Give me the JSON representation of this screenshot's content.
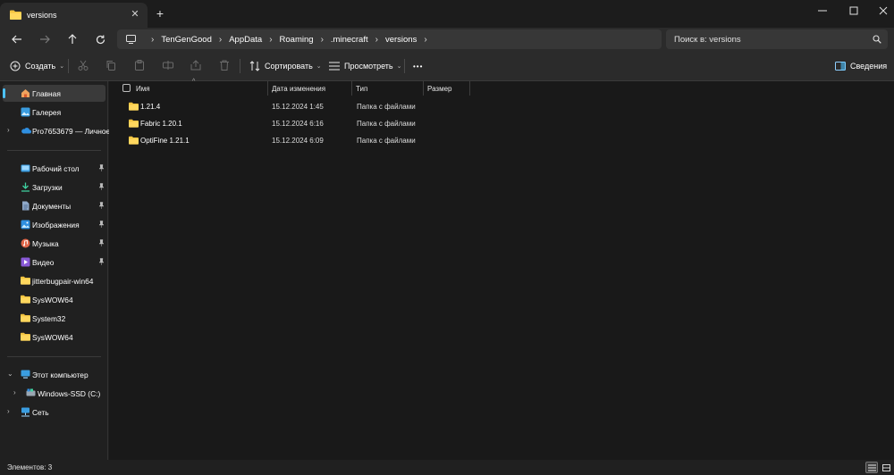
{
  "window": {
    "tab_title": "versions",
    "tab_close": "✕",
    "new_tab": "+"
  },
  "colors": {
    "folder": "#f3c441",
    "accent": "#4cc2ff",
    "background": "#191919",
    "chrome": "#2b2b2b"
  },
  "address": {
    "breadcrumbs": [
      "TenGenGood",
      "AppData",
      "Roaming",
      ".minecraft",
      "versions"
    ],
    "search_placeholder": "Поиск в: versions"
  },
  "toolbar": {
    "create_label": "Создать",
    "sort_label": "Сортировать",
    "view_label": "Просмотреть",
    "more_label": "•••",
    "details_label": "Сведения"
  },
  "sidebar": {
    "top_items": [
      {
        "label": "Главная",
        "icon": "home-icon",
        "selected": true
      },
      {
        "label": "Галерея",
        "icon": "gallery-icon"
      },
      {
        "label": "Pro7653679 — Личное",
        "icon": "onedrive-icon",
        "expandable": true
      }
    ],
    "quick_access": [
      {
        "label": "Рабочий стол",
        "icon": "desktop-icon",
        "pinned": true
      },
      {
        "label": "Загрузки",
        "icon": "downloads-icon",
        "pinned": true
      },
      {
        "label": "Документы",
        "icon": "documents-icon",
        "pinned": true
      },
      {
        "label": "Изображения",
        "icon": "pictures-icon",
        "pinned": true
      },
      {
        "label": "Музыка",
        "icon": "music-icon",
        "pinned": true
      },
      {
        "label": "Видео",
        "icon": "videos-icon",
        "pinned": true
      },
      {
        "label": "jitterbugpair-win64",
        "icon": "folder-icon"
      },
      {
        "label": "SysWOW64",
        "icon": "folder-icon"
      },
      {
        "label": "System32",
        "icon": "folder-icon"
      },
      {
        "label": "SysWOW64",
        "icon": "folder-icon"
      }
    ],
    "devices": [
      {
        "label": "Этот компьютер",
        "icon": "this-pc-icon",
        "expanded": true
      },
      {
        "label": "Windows-SSD (C:)",
        "icon": "drive-icon",
        "expandable": true
      },
      {
        "label": "Сеть",
        "icon": "network-icon",
        "expandable": true
      }
    ]
  },
  "columns": {
    "name": "Имя",
    "date": "Дата изменения",
    "type": "Тип",
    "size": "Размер"
  },
  "files": [
    {
      "name": "1.21.4",
      "date": "15.12.2024 1:45",
      "type": "Папка с файлами",
      "size": ""
    },
    {
      "name": "Fabric 1.20.1",
      "date": "15.12.2024 6:16",
      "type": "Папка с файлами",
      "size": ""
    },
    {
      "name": "OptiFine 1.21.1",
      "date": "15.12.2024 6:09",
      "type": "Папка с файлами",
      "size": ""
    }
  ],
  "status": {
    "item_count": "Элементов: 3"
  }
}
